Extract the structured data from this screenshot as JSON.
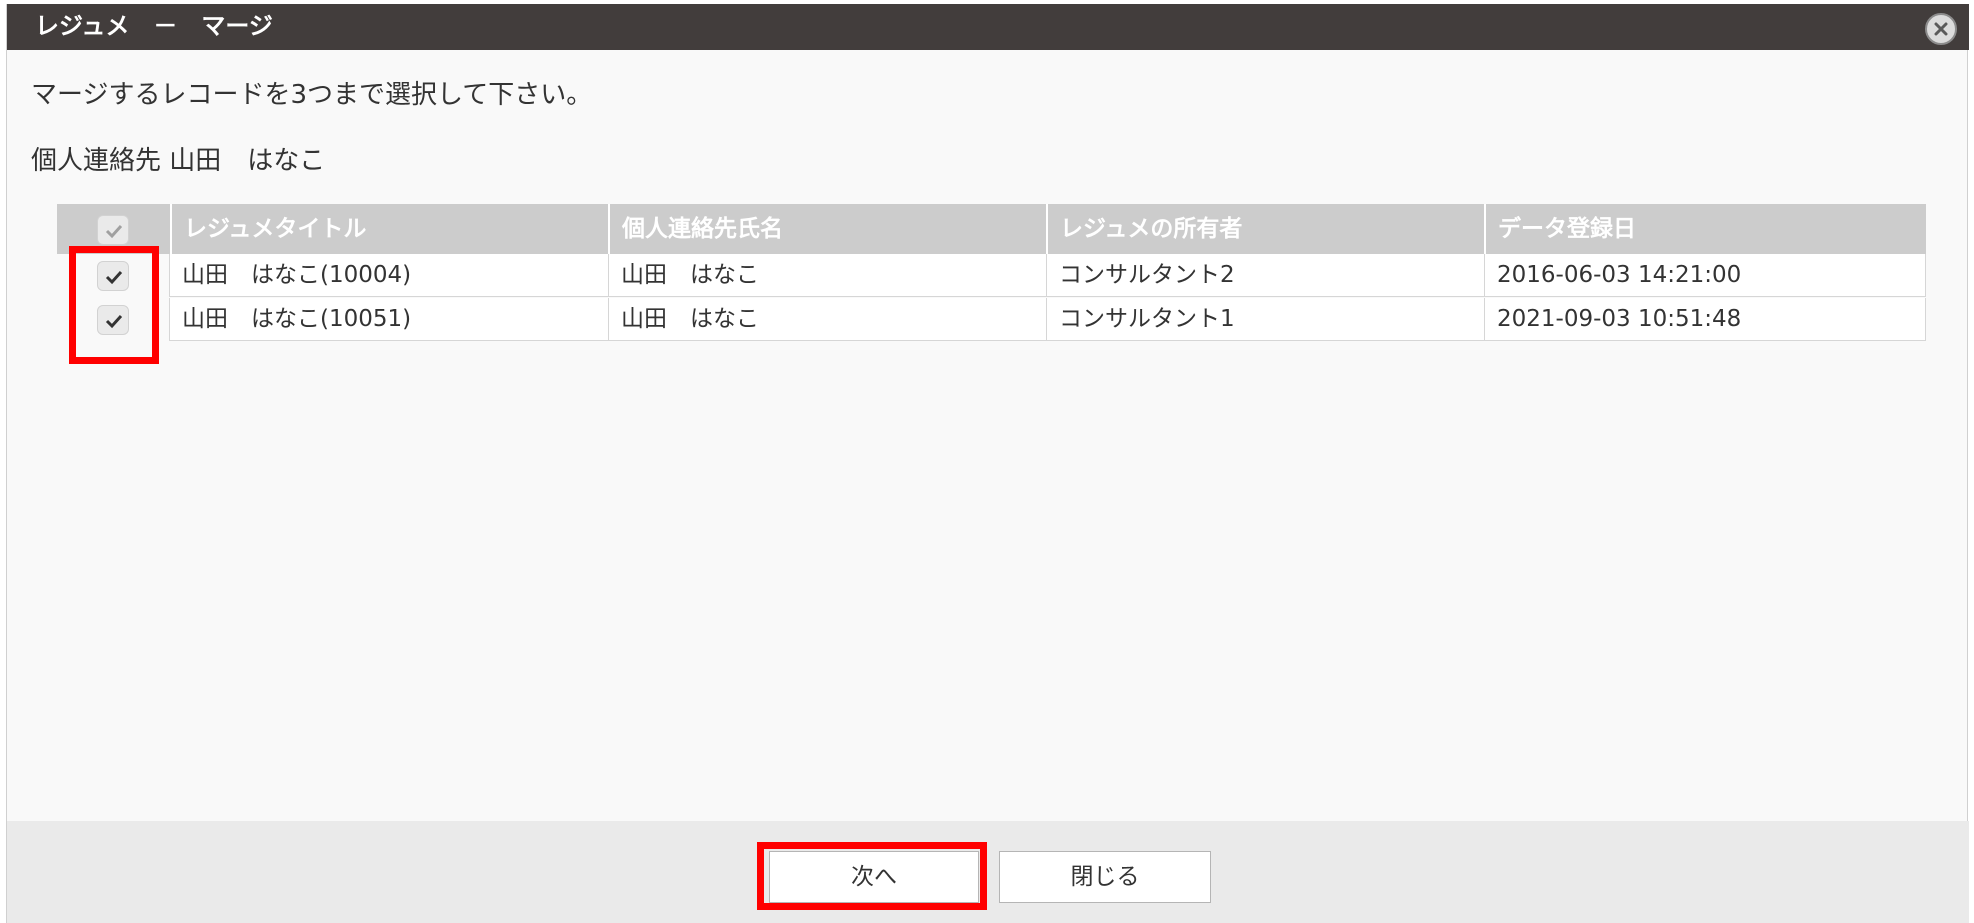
{
  "dialog": {
    "title": "レジュメ　－　マージ",
    "instruction": "マージするレコードを3つまで選択して下さい。",
    "contact_line": "個人連絡先 山田　はなこ"
  },
  "table": {
    "columns": [
      "レジュメタイトル",
      "個人連絡先氏名",
      "レジュメの所有者",
      "データ登録日"
    ],
    "rows": [
      {
        "checked": true,
        "title": "山田　はなこ(10004)",
        "contact_name": "山田　はなこ",
        "owner": "コンサルタント2",
        "created": "2016-06-03 14:21:00"
      },
      {
        "checked": true,
        "title": "山田　はなこ(10051)",
        "contact_name": "山田　はなこ",
        "owner": "コンサルタント1",
        "created": "2021-09-03 10:51:48"
      }
    ]
  },
  "buttons": {
    "next_label": "次へ",
    "close_label": "閉じる"
  },
  "colors": {
    "titlebar": "#423d3c",
    "highlight": "#ff0000",
    "header": "#cccccc"
  }
}
